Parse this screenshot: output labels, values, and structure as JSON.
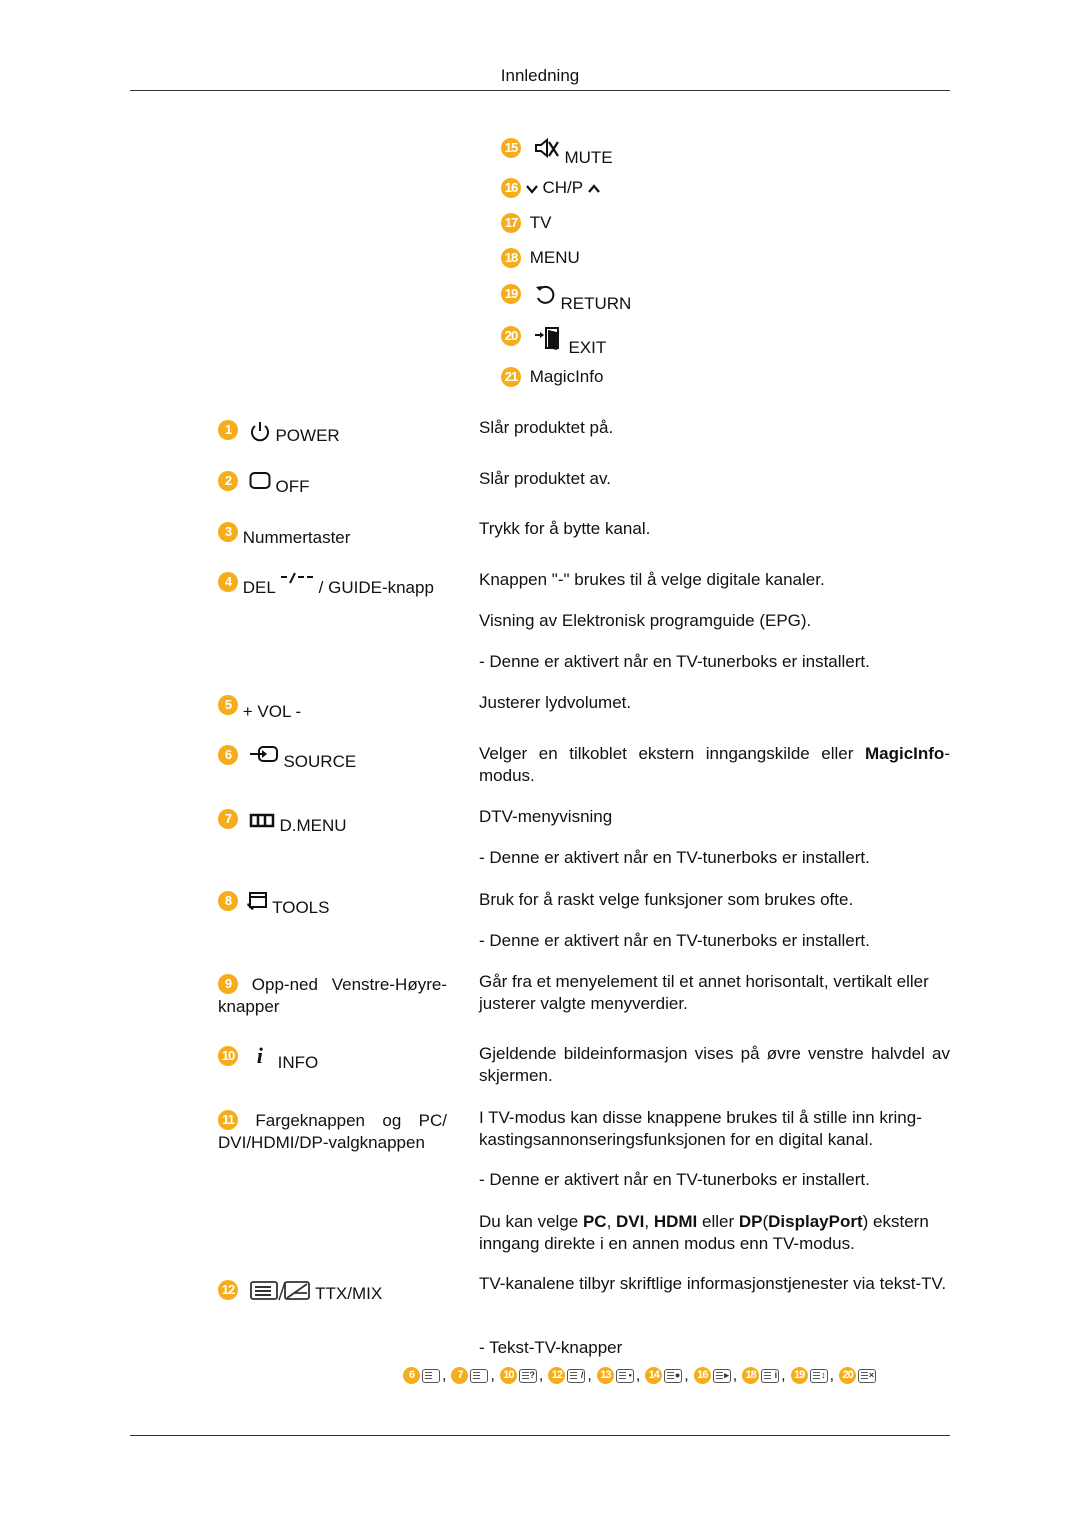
{
  "header": {
    "title": "Innledning"
  },
  "top_buttons": [
    {
      "num": "15",
      "icon": "mute-icon",
      "label": "MUTE"
    },
    {
      "num": "16",
      "icon": "channel-icon",
      "label": "CH/P"
    },
    {
      "num": "17",
      "label": "TV"
    },
    {
      "num": "18",
      "label": "MENU"
    },
    {
      "num": "19",
      "icon": "return-icon",
      "label": "RETURN"
    },
    {
      "num": "20",
      "icon": "exit-icon",
      "label": "EXIT"
    },
    {
      "num": "21",
      "label": "MagicInfo"
    }
  ],
  "buttons": [
    {
      "num": "1",
      "icon": "power-icon",
      "label": "POWER",
      "desc": [
        "Slår produktet på."
      ]
    },
    {
      "num": "2",
      "icon": "off-icon",
      "label": "OFF",
      "desc": [
        "Slår produktet av."
      ]
    },
    {
      "num": "3",
      "label": "Nummertaster",
      "desc": [
        "Trykk for å bytte kanal."
      ]
    },
    {
      "num": "4",
      "label_pre": "DEL",
      "icon": "del-dash-icon",
      "label": "/ GUIDE-knapp",
      "desc": [
        "Knappen \"-\" brukes til å velge digitale kanaler.",
        "Visning av Elektronisk programguide (EPG).",
        "- Denne er aktivert når en TV-tunerboks er installert."
      ]
    },
    {
      "num": "5",
      "label": "+ VOL -",
      "desc": [
        "Justerer lydvolumet."
      ]
    },
    {
      "num": "6",
      "icon": "source-icon",
      "label": "SOURCE",
      "desc_parts": {
        "pre": "Velger en tilkoblet ekstern inngangskilde eller ",
        "bold": "MagicInfo",
        "post": "-modus."
      }
    },
    {
      "num": "7",
      "icon": "dmenu-icon",
      "label": "D.MENU",
      "desc": [
        "DTV-menyvisning",
        "- Denne er aktivert når en TV-tunerboks er installert."
      ]
    },
    {
      "num": "8",
      "icon": "tools-icon",
      "label": "TOOLS",
      "desc": [
        "Bruk for å raskt velge funksjoner som brukes ofte.",
        "- Denne er aktivert når en TV-tunerboks er installert."
      ]
    },
    {
      "num": "9",
      "label": "Opp-ned Venstre-Høyre-knapper",
      "desc": [
        "Går fra et menyelement til et annet horisontalt, vertikalt eller justerer valgte menyverdier."
      ]
    },
    {
      "num": "10",
      "icon": "info-icon",
      "label": "INFO",
      "desc": [
        "Gjeldende bildeinformasjon vises på øvre venstre halvdel av skjermen."
      ]
    },
    {
      "num": "11",
      "label": "Fargeknappen og PC/ DVI/HDMI/DP-valgknappen",
      "desc": [
        "I TV-modus kan disse knappene brukes til å stille inn kring-kastingsannonseringsfunksjonen for en digital kanal.",
        "- Denne er aktivert når en TV-tunerboks er installert."
      ],
      "desc_parts": {
        "p1": "Du kan velge ",
        "b1": "PC",
        "s1": ", ",
        "b2": "DVI",
        "s2": ", ",
        "b3": "HDMI",
        "s3": " eller ",
        "b4": "DP",
        "s4": "(",
        "b5": "DisplayPort",
        "post": ") ekstern inngang direkte i en annen modus enn TV-modus."
      }
    },
    {
      "num": "12",
      "icon": "ttx-mix-icon",
      "label": "TTX/MIX",
      "desc": [
        "TV-kanalene tilbyr skriftlige informasjonstjenester via tekst-TV.",
        "- Tekst-TV-knapper"
      ]
    }
  ],
  "ttx_buttons": [
    {
      "num": "6",
      "glyph": ""
    },
    {
      "num": "7",
      "glyph": ""
    },
    {
      "num": "10",
      "glyph": "?"
    },
    {
      "num": "12",
      "glyph": "/"
    },
    {
      "num": "13",
      "glyph": "•"
    },
    {
      "num": "14",
      "glyph": "●"
    },
    {
      "num": "16",
      "glyph": "▸"
    },
    {
      "num": "18",
      "glyph": "i"
    },
    {
      "num": "19",
      "glyph": "↕"
    },
    {
      "num": "20",
      "glyph": "×"
    }
  ],
  "separator": ","
}
